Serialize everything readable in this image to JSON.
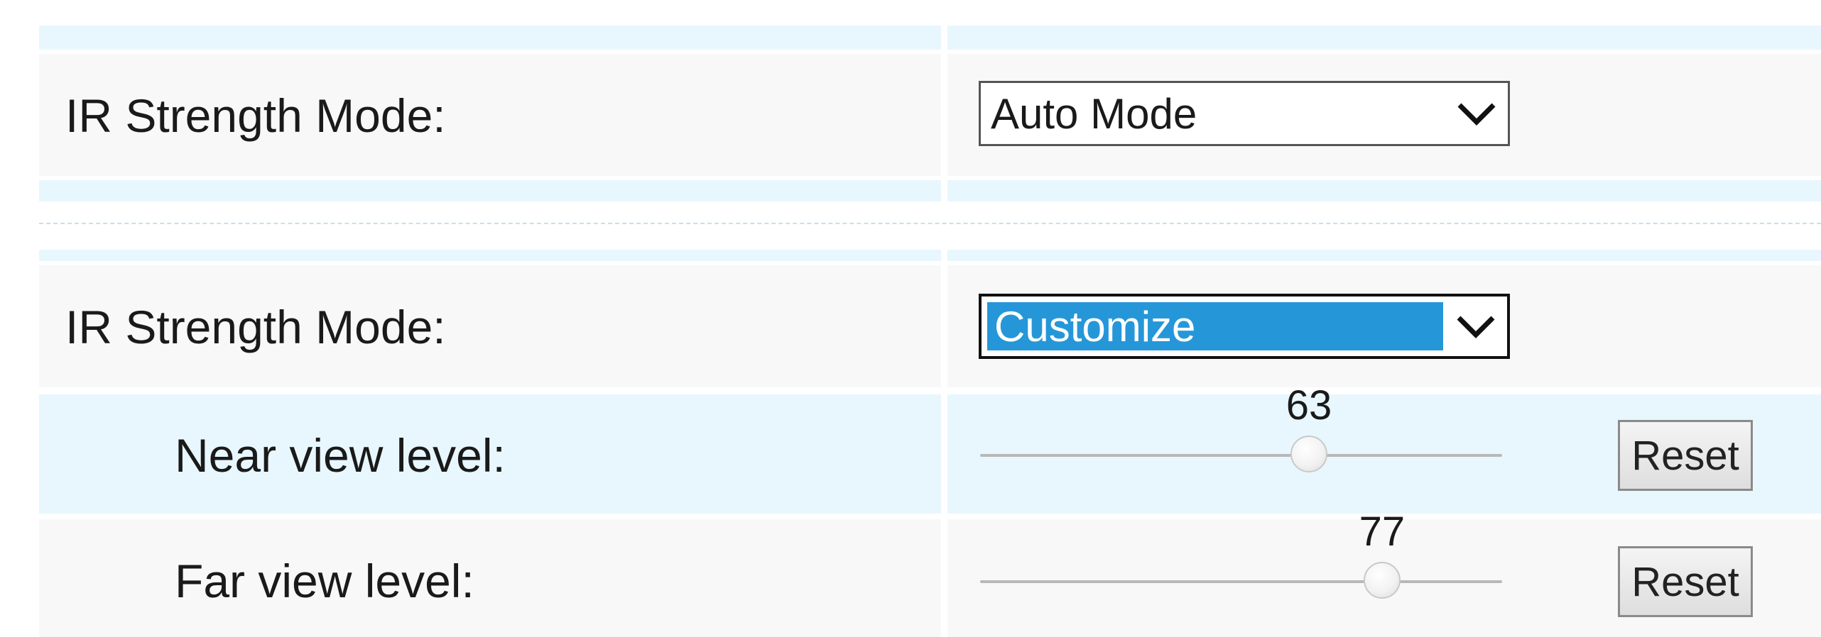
{
  "auto_section": {
    "label": "IR Strength Mode:",
    "select_value": "Auto Mode"
  },
  "custom_section": {
    "label": "IR Strength Mode:",
    "select_value": "Customize",
    "near_view": {
      "label": "Near view level:",
      "value": "63",
      "level": 63,
      "max": 100,
      "reset_label": "Reset"
    },
    "far_view": {
      "label": "Far view level:",
      "value": "77",
      "level": 77,
      "max": 100,
      "reset_label": "Reset"
    }
  },
  "colors": {
    "band_light": "#e8f7fd",
    "band_grey": "#f8f8f8",
    "select_highlight": "#2597d9"
  },
  "icons": {
    "dropdown": "chevron-down-icon",
    "slider_thumb": "slider-thumb"
  }
}
